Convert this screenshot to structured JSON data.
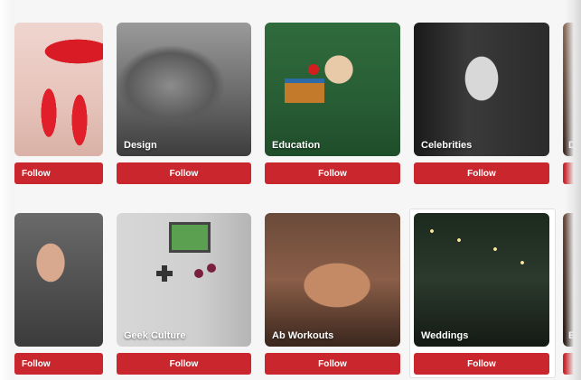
{
  "categories": {
    "row1": [
      {
        "id": "partial-left-top",
        "label": "",
        "image": "nails"
      },
      {
        "id": "design",
        "label": "Design",
        "image": "design"
      },
      {
        "id": "education",
        "label": "Education",
        "image": "education"
      },
      {
        "id": "celebrities",
        "label": "Celebrities",
        "image": "celebrities"
      },
      {
        "id": "partial-right-top",
        "label": "Di",
        "image": "partial"
      }
    ],
    "row2": [
      {
        "id": "partial-left-bottom",
        "label": "",
        "image": "fitness"
      },
      {
        "id": "geek-culture",
        "label": "Geek Culture",
        "image": "geek"
      },
      {
        "id": "ab-workouts",
        "label": "Ab Workouts",
        "image": "abs"
      },
      {
        "id": "weddings",
        "label": "Weddings",
        "image": "weddings"
      },
      {
        "id": "partial-right-bottom",
        "label": "Ey",
        "image": "partial"
      }
    ]
  },
  "follow_label": "Follow",
  "colors": {
    "follow_button": "#c9272d",
    "background": "#f6f6f6"
  }
}
